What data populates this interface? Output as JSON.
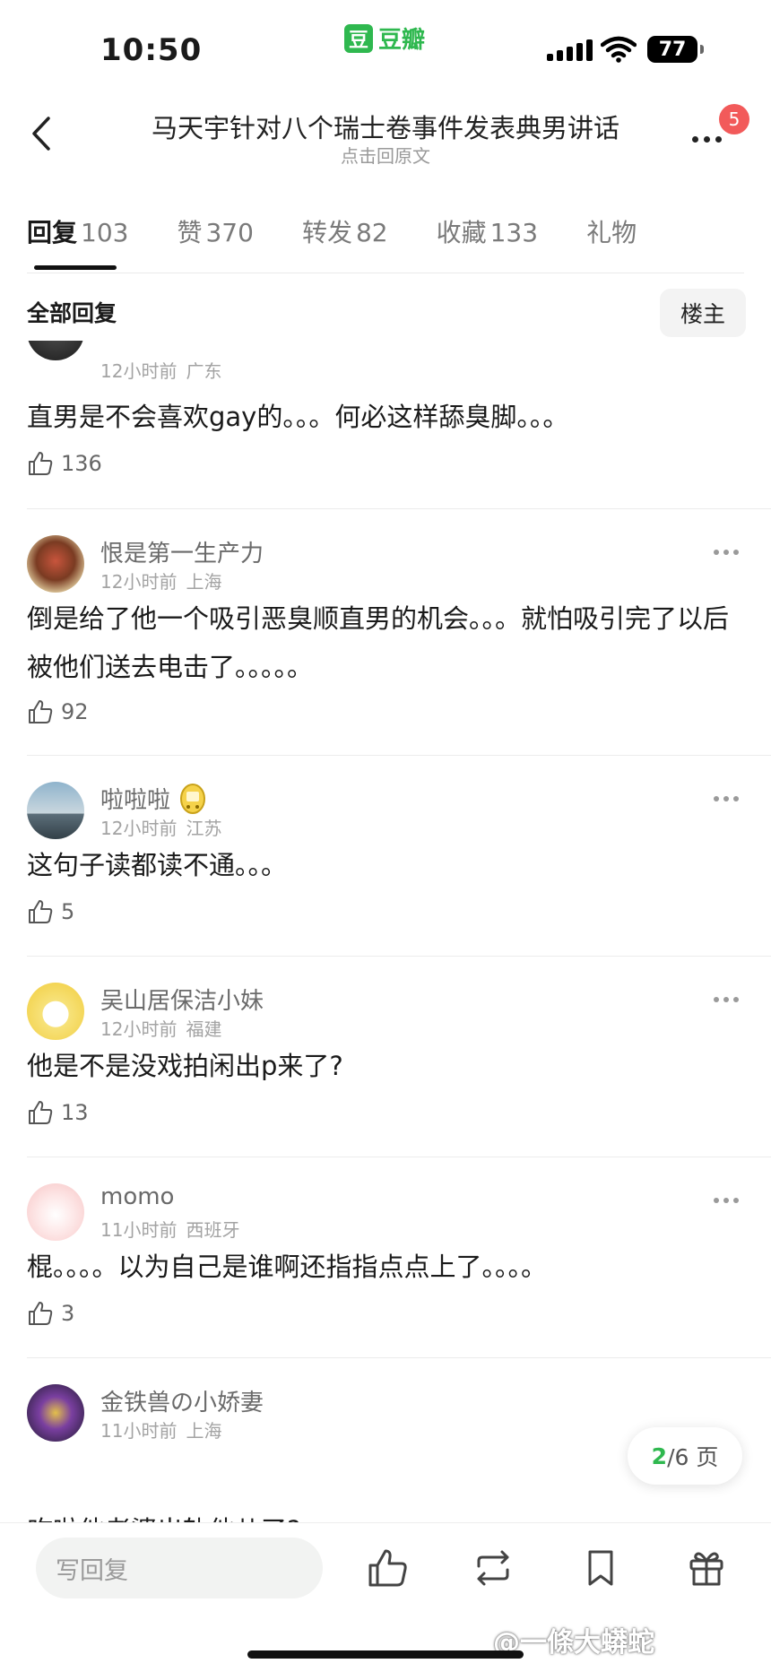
{
  "status_bar": {
    "time": "10:50",
    "app_name": "豆瓣",
    "app_logo_char": "豆",
    "battery": "77"
  },
  "header": {
    "title": "马天宇针对八个瑞士卷事件发表典男讲话",
    "subtitle": "点击回原文",
    "notification_count": "5"
  },
  "tabs": [
    {
      "label": "回复",
      "count": "103",
      "active": true
    },
    {
      "label": "赞",
      "count": "370"
    },
    {
      "label": "转发",
      "count": "82"
    },
    {
      "label": "收藏",
      "count": "133"
    },
    {
      "label": "礼物",
      "count": ""
    }
  ],
  "filter": {
    "label": "全部回复",
    "op_button": "楼主"
  },
  "comments": [
    {
      "user": "",
      "time": "12小时前",
      "location": "广东",
      "text": "直男是不会喜欢gay的。。。何必这样舔臭脚。。。",
      "likes": "136"
    },
    {
      "user": "恨是第一生产力",
      "time": "12小时前",
      "location": "上海",
      "text": "倒是给了他一个吸引恶臭顺直男的机会。。。就怕吸引完了以后被他们送去电击了。。。。。",
      "likes": "92"
    },
    {
      "user": "啦啦啦",
      "time": "12小时前",
      "location": "江苏",
      "text": "这句子读都读不通。。。",
      "likes": "5"
    },
    {
      "user": "吴山居保洁小妹",
      "time": "12小时前",
      "location": "福建",
      "text": "他是不是没戏拍闲出p来了?",
      "likes": "13"
    },
    {
      "user": "momo",
      "time": "11小时前",
      "location": "西班牙",
      "text": "棍。。。。以为自己是谁啊还指指点点上了。。。。",
      "likes": "3"
    },
    {
      "user": "金铁兽の小娇妻",
      "time": "11小时前",
      "location": "上海",
      "text": "咋啦他老婆出轨他儿了?",
      "likes": ""
    }
  ],
  "pager": {
    "current": "2",
    "total_text": "/6 页"
  },
  "bottom_bar": {
    "reply_placeholder": "写回复"
  },
  "watermark": "@一條大蟒蛇",
  "colors": {
    "accent": "#2fb84f",
    "badge": "#f25a5a"
  }
}
